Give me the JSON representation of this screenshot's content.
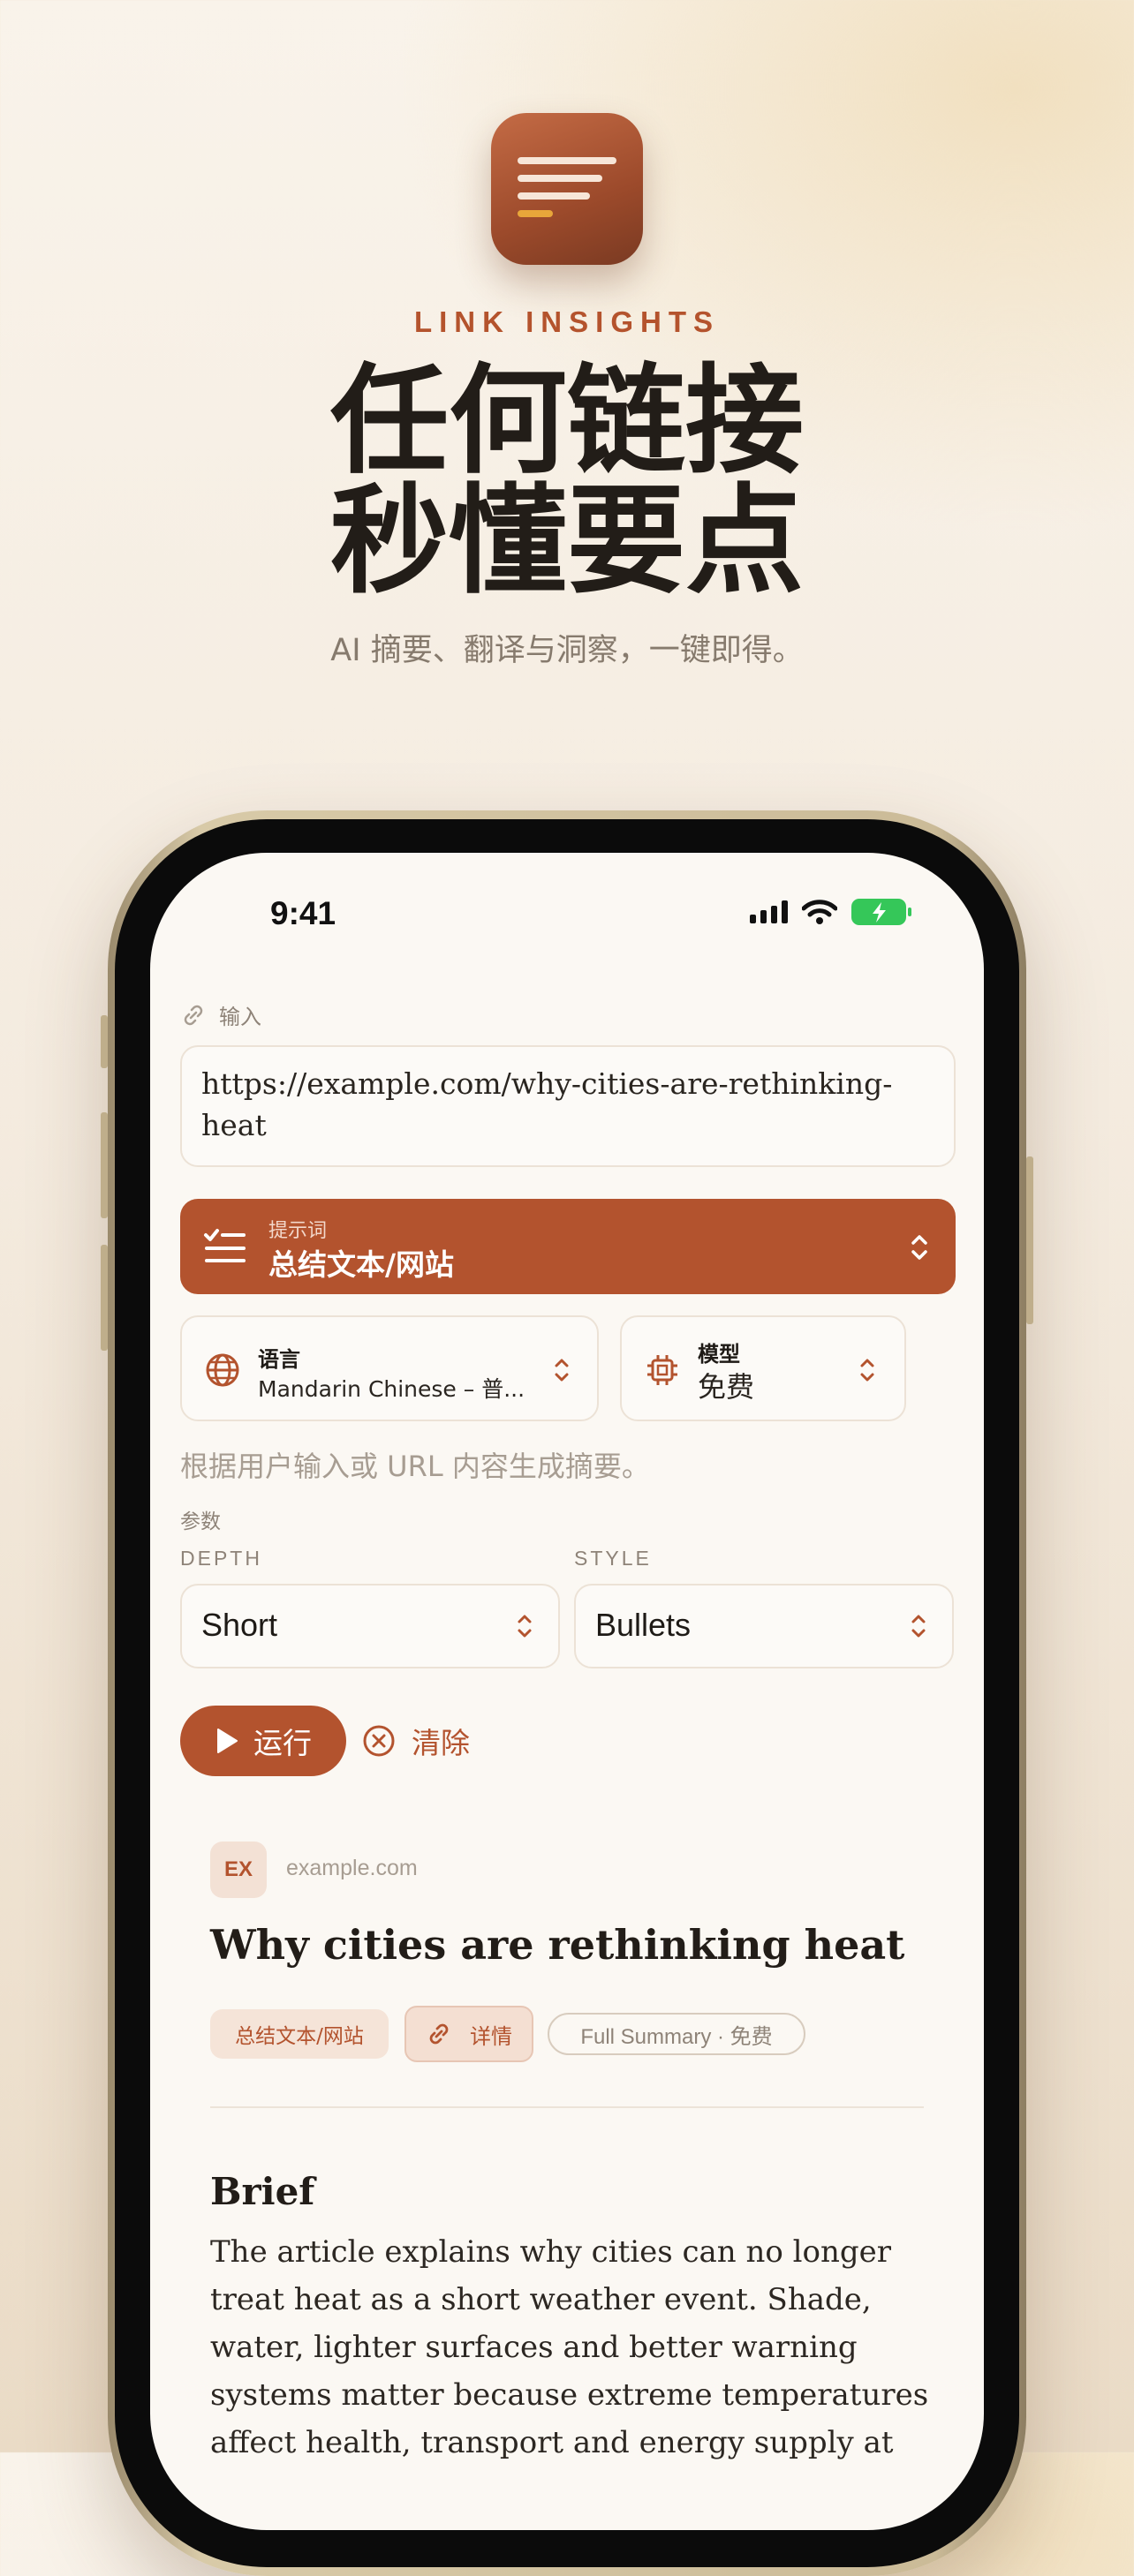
{
  "hero": {
    "brand": "LINK INSIGHTS",
    "headline_line1": "任何链接",
    "headline_line2": "秒懂要点",
    "subtitle": "AI 摘要、翻译与洞察，一键即得。"
  },
  "status_bar": {
    "time": "9:41"
  },
  "input": {
    "label": "输入",
    "url": "https://example.com/why-cities-are-rethinking-heat"
  },
  "prompt": {
    "small_label": "提示词",
    "value": "总结文本/网站"
  },
  "language": {
    "title": "语言",
    "value": "Mandarin Chinese – 普..."
  },
  "model": {
    "title": "模型",
    "value": "免费"
  },
  "description": "根据用户输入或 URL 内容生成摘要。",
  "params": {
    "label": "参数",
    "depth_label": "DEPTH",
    "depth_value": "Short",
    "style_label": "STYLE",
    "style_value": "Bullets"
  },
  "actions": {
    "run": "运行",
    "clear": "清除"
  },
  "result": {
    "badge": "EX",
    "domain": "example.com",
    "title": "Why cities are rethinking heat",
    "tag_prompt": "总结文本/网站",
    "tag_details": "详情",
    "tag_meta": "Full Summary · 免费",
    "brief_heading": "Brief",
    "brief_text": "The article explains why cities can no longer treat heat as a short weather event. Shade, water, lighter surfaces and better warning systems matter because extreme temperatures affect health, transport and energy supply at"
  },
  "colors": {
    "accent": "#b3532e",
    "background": "#f7efe4",
    "battery": "#35c759"
  }
}
